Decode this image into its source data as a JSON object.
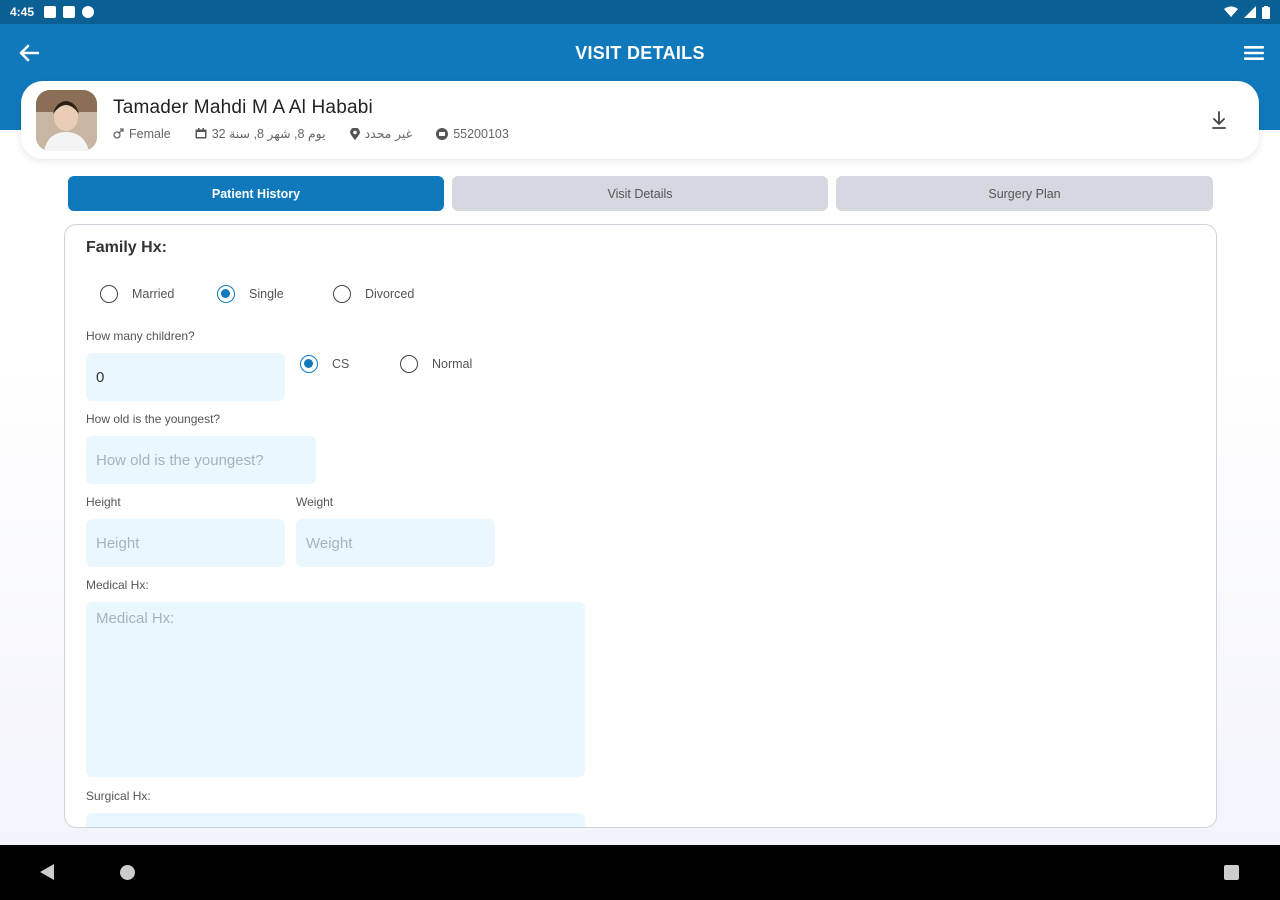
{
  "status_bar": {
    "time": "4:45"
  },
  "app_bar": {
    "title": "VISIT DETAILS"
  },
  "patient": {
    "name": "Tamader Mahdi M A Al Hababi",
    "gender": "Female",
    "age": "32 يوم 8, شهر 8, سنة",
    "location": "غير محدد",
    "id": "55200103"
  },
  "tabs": [
    {
      "label": "Patient History",
      "active": true
    },
    {
      "label": "Visit Details",
      "active": false
    },
    {
      "label": "Surgery Plan",
      "active": false
    }
  ],
  "form": {
    "section_title": "Family Hx:",
    "marital_options": [
      {
        "label": "Married",
        "checked": false
      },
      {
        "label": "Single",
        "checked": true
      },
      {
        "label": "Divorced",
        "checked": false
      }
    ],
    "children_label": "How many children?",
    "children_value": "0",
    "delivery_options": [
      {
        "label": "CS",
        "checked": true
      },
      {
        "label": "Normal",
        "checked": false
      }
    ],
    "youngest_label": "How old is the youngest?",
    "youngest_placeholder": "How old is the youngest?",
    "height_label": "Height",
    "height_placeholder": "Height",
    "weight_label": "Weight",
    "weight_placeholder": "Weight",
    "medical_label": "Medical Hx:",
    "medical_placeholder": "Medical Hx:",
    "surgical_label": "Surgical Hx:"
  },
  "colors": {
    "primary": "#1079bb",
    "status_bar": "#0a5f95",
    "input_bg": "#eaf7fe",
    "tab_inactive": "#d5d8e1"
  },
  "icons": {
    "back": "arrow-left-icon",
    "menu": "hamburger-menu-icon",
    "download": "download-icon",
    "gender": "gender-icon",
    "calendar": "calendar-icon",
    "location": "location-pin-icon",
    "id": "id-badge-icon"
  }
}
